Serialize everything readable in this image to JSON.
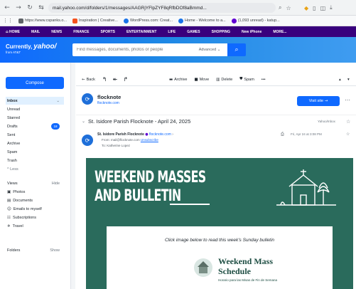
{
  "browser": {
    "url": "mail.yahoo.com/d/folders/1/messages/AAGRjYFlpZYF8qRfbDOf8aBmmd...",
    "bookmarks": [
      {
        "label": "https://www.cspanks.o...",
        "color": "#5f6368"
      },
      {
        "label": "Inspiration | Creative...",
        "color": "#f4511e"
      },
      {
        "label": "WordPress.com: Creat...",
        "color": "#1a73e8"
      },
      {
        "label": "Home - Welcome to a...",
        "color": "#1a73e8"
      },
      {
        "label": "(1,093 unread) - katup...",
        "color": "#6001d2"
      }
    ]
  },
  "yahoo_nav": [
    "HOME",
    "MAIL",
    "NEWS",
    "FINANCE",
    "SPORTS",
    "ENTERTAINMENT",
    "LIFE",
    "GAMES",
    "SHOPPING",
    "New iPhone",
    "MORE..."
  ],
  "header": {
    "logo_line1": "Currently",
    "logo_line2": "from AT&T",
    "logo_yahoo": "yahoo/",
    "search_placeholder": "Find messages, documents, photos or people",
    "advanced_label": "Advanced"
  },
  "sidebar": {
    "compose": "Compose",
    "folders": [
      {
        "label": "Inbox",
        "active": true
      },
      {
        "label": "Unread"
      },
      {
        "label": "Starred"
      },
      {
        "label": "Drafts",
        "badge": "18"
      },
      {
        "label": "Sent"
      },
      {
        "label": "Archive"
      },
      {
        "label": "Spam"
      },
      {
        "label": "Trash"
      },
      {
        "label": "^ Less"
      }
    ],
    "views_label": "Views",
    "views_action": "Hide",
    "views": [
      "Photos",
      "Documents",
      "Emails to myself",
      "Subscriptions",
      "Travel"
    ],
    "folders_label": "Folders",
    "folders_action": "Show"
  },
  "toolbar": {
    "back": "Back",
    "archive": "Archive",
    "move": "Move",
    "delete": "Delete",
    "spam": "Spam",
    "more": "•••"
  },
  "sender": {
    "name": "flocknote",
    "site": "flocknote.com",
    "visit_label": "Visit site"
  },
  "subject": {
    "text": "St. Isidore Parish Flocknote - April 24, 2025",
    "tag": "Yahoo/Inbox"
  },
  "message": {
    "from_name": "St. Isidore Parish Flocknote",
    "from_addr": "flocknote.com",
    "from_line": "From: mail@flocknote.com",
    "unsubscribe": "Unsubscribe",
    "to_line": "To: Katherine Lopez",
    "date": "Fri, Apr 24 at 3:08 PM"
  },
  "newsletter": {
    "banner_line1": "WEEKEND MASSES",
    "banner_line2": "AND BULLETIN",
    "caption": "Click image below to read this week's Sunday bulletin",
    "card_title_1": "Weekend Mass",
    "card_title_2": "Schedule",
    "card_sub": "Horario para las Misas de Fin de Semana"
  }
}
